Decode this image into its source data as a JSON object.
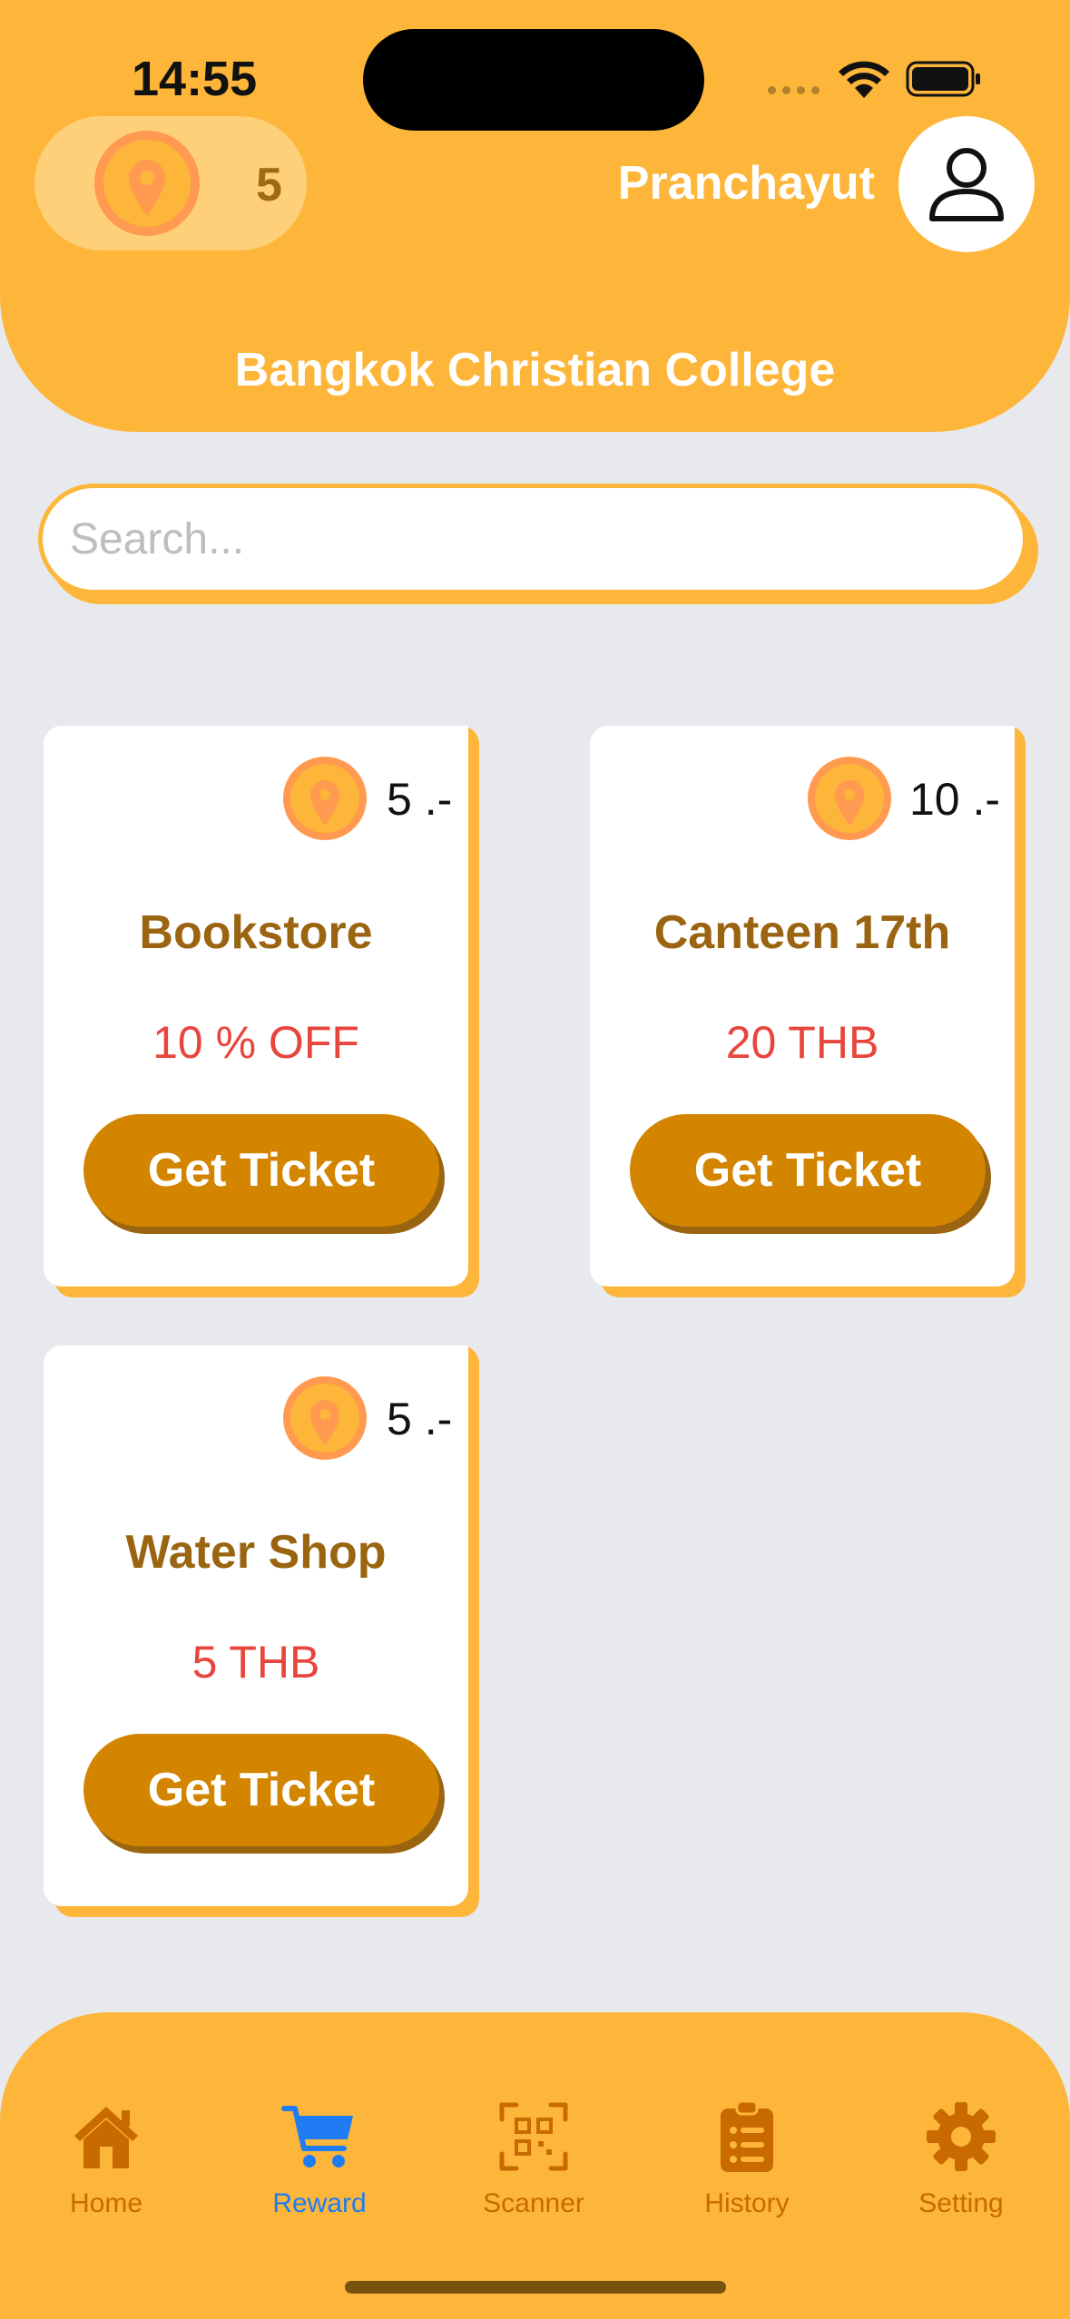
{
  "status_bar": {
    "time": "14:55"
  },
  "header": {
    "points": "5",
    "username": "Pranchayut",
    "title": "Bangkok Christian College"
  },
  "search": {
    "placeholder": "Search..."
  },
  "rewards": [
    {
      "points": "5 .-",
      "title": "Bookstore",
      "discount": "10 % OFF",
      "button": "Get Ticket"
    },
    {
      "points": "10 .-",
      "title": "Canteen 17th",
      "discount": "20 THB",
      "button": "Get Ticket"
    },
    {
      "points": "5 .-",
      "title": "Water Shop",
      "discount": "5 THB",
      "button": "Get Ticket"
    }
  ],
  "tabs": [
    {
      "label": "Home",
      "icon": "home-icon"
    },
    {
      "label": "Reward",
      "icon": "cart-icon",
      "active": true
    },
    {
      "label": "Scanner",
      "icon": "qr-scanner-icon"
    },
    {
      "label": "History",
      "icon": "clipboard-list-icon"
    },
    {
      "label": "Setting",
      "icon": "gear-icon"
    }
  ],
  "colors": {
    "accent": "#FDB639",
    "button": "#D38500",
    "title_brown": "#9A6410",
    "discount_red": "#E8453C",
    "tab_active": "#1F7CF2",
    "tab_inactive": "#C86A00"
  }
}
